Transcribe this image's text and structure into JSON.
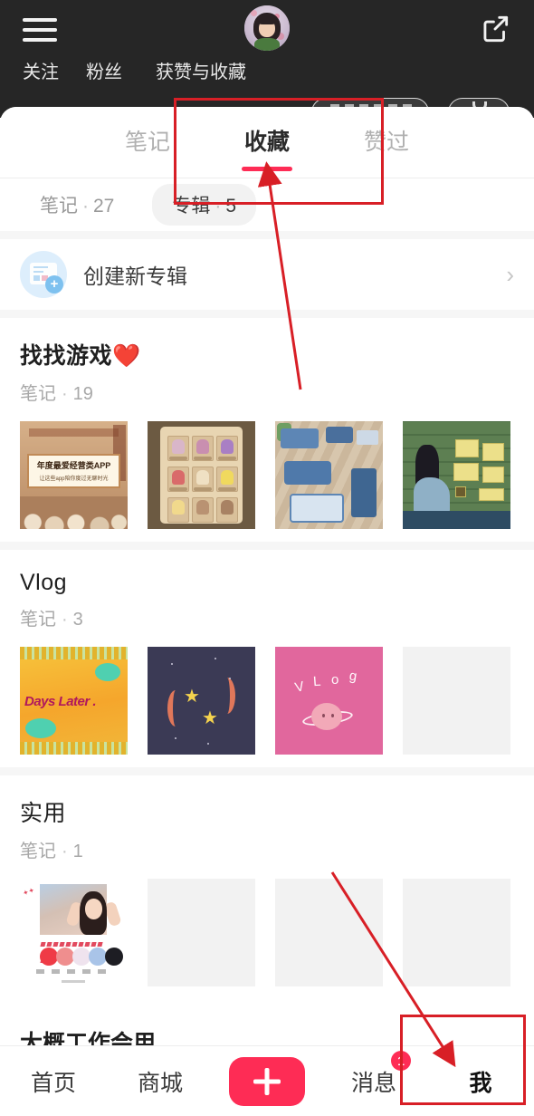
{
  "header": {
    "menu_icon": "hamburger-icon",
    "avatar_icon": "user-avatar",
    "share_icon": "share-external-icon",
    "stats": [
      {
        "label": "关注"
      },
      {
        "label": "粉丝"
      },
      {
        "label": "获赞与收藏"
      }
    ],
    "edit_profile_button": "",
    "gear_button": ""
  },
  "tabs": [
    {
      "label": "笔记",
      "active": false
    },
    {
      "label": "收藏",
      "active": true
    },
    {
      "label": "赞过",
      "active": false
    }
  ],
  "filters": [
    {
      "label": "笔记",
      "sep": "·",
      "count": "27",
      "selected": false
    },
    {
      "label": "专辑",
      "sep": "·",
      "count": "5",
      "selected": true
    }
  ],
  "create_album": {
    "label": "创建新专辑",
    "icon": "create-album-icon",
    "chevron": "›"
  },
  "albums": [
    {
      "title": "找找游戏❤️",
      "meta_label": "笔记",
      "meta_sep": "·",
      "meta_count": "19",
      "thumbs": [
        {
          "name": "thumb-game-app-award",
          "caption": "年度最爱经营类APP",
          "subcaption": "让这些app陪你度过无聊时光"
        },
        {
          "name": "thumb-game-drinks-grid",
          "caption": ""
        },
        {
          "name": "thumb-game-isometric-room",
          "caption": ""
        },
        {
          "name": "thumb-game-wall-notes",
          "caption": ""
        }
      ]
    },
    {
      "title": "Vlog",
      "meta_label": "笔记",
      "meta_sep": "·",
      "meta_count": "3",
      "thumbs": [
        {
          "name": "thumb-days-later",
          "caption": "Days Later ."
        },
        {
          "name": "thumb-stars-night",
          "caption": ""
        },
        {
          "name": "thumb-vlog-planet",
          "caption": "V L o g"
        },
        {
          "name": "thumb-empty",
          "caption": ""
        }
      ]
    },
    {
      "title": "实用",
      "meta_label": "笔记",
      "meta_sep": "·",
      "meta_count": "1",
      "thumbs": [
        {
          "name": "thumb-color-palette",
          "caption": ""
        },
        {
          "name": "thumb-empty",
          "caption": ""
        },
        {
          "name": "thumb-empty",
          "caption": ""
        },
        {
          "name": "thumb-empty",
          "caption": ""
        }
      ]
    }
  ],
  "cut_off_album": {
    "title": "大概工作会用"
  },
  "bottom_nav": {
    "items": [
      {
        "label": "首页",
        "active": false,
        "badge": ""
      },
      {
        "label": "商城",
        "active": false,
        "badge": ""
      },
      {
        "label": "消息",
        "active": false,
        "badge": "1"
      },
      {
        "label": "我",
        "active": true,
        "badge": ""
      }
    ],
    "create_button": "plus-icon"
  },
  "annotations": {
    "accent_color": "#d81f26",
    "box_tabs_target": "收藏",
    "box_nav_target": "我"
  },
  "colors": {
    "brand_red": "#fe2c55",
    "header_dark": "#262626",
    "sheet_white": "#ffffff",
    "muted_gray": "#a8a8a8",
    "chip_bg": "#f2f2f2",
    "annotation_red": "#d81f26"
  }
}
